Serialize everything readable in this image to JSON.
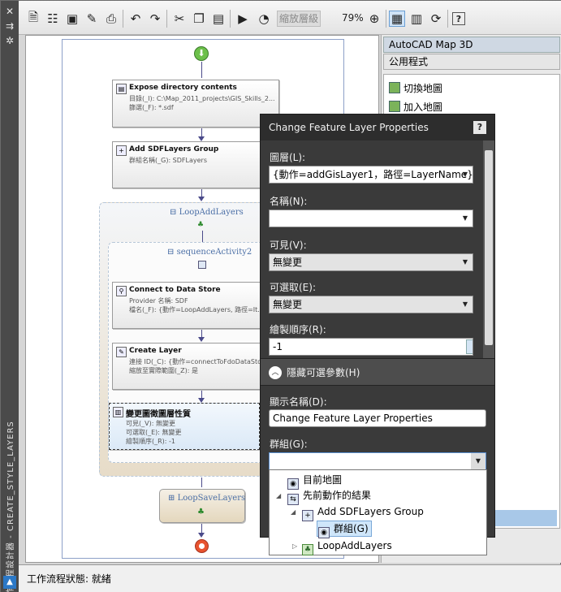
{
  "sidebar": {
    "vertical_title": "工作流程設計器 - CREATE_STYLE_LAYERS",
    "close_glyph": "✕",
    "pin_glyph": "⇉",
    "settings_glyph": "✲",
    "badge_glyph": "▲"
  },
  "toolbar": {
    "icons": [
      "new-workflow-icon",
      "properties-icon",
      "save-icon",
      "edit-icon",
      "print-icon",
      "undo-icon",
      "redo-icon",
      "cut-icon",
      "copy-icon",
      "paste-icon",
      "run-icon",
      "ungroup-icon"
    ],
    "zoom_label": "縮放層級",
    "zoom_value": "79%",
    "right_icons": [
      "zoom-icon",
      "layout-panel-icon",
      "document-icon",
      "refresh-icon",
      "help-icon"
    ]
  },
  "workflow": {
    "activities": [
      {
        "title": "Expose directory contents",
        "lines": [
          "目錄(_I): C:\\Map_2011_projects\\GIS_Skills_2...",
          "篩選(_F): *.sdf"
        ]
      },
      {
        "title": "Add SDFLayers Group",
        "lines": [
          "群組名稱(_G): SDFLayers"
        ]
      },
      {
        "title": "Connect to Data Store",
        "lines": [
          "Provider 名稱: SDF",
          "檔名(_F): {動作=LoopAddLayers, 路徑=It..."
        ]
      },
      {
        "title": "Create Layer",
        "lines": [
          "連接 ID(_C): {動作=connectToFdoDataSto...",
          "縮放至實際範圍(_Z): 是"
        ]
      },
      {
        "title": "變更圖徵圖層性質",
        "lines": [
          "可見(_V): 無變更",
          "可選取(_E): 無變更",
          "繪製順序(_R): -1"
        ]
      }
    ],
    "loop_label": "LoopAddLayers",
    "sequence_label": "sequenceActivity2",
    "save_label": "LoopSaveLayers"
  },
  "right_panel": {
    "tab1": "AutoCAD Map 3D",
    "tab2": "公用程式",
    "items": [
      "切換地圖",
      "加入地圖"
    ]
  },
  "dialog": {
    "title": "Change Feature Layer Properties",
    "help": "?",
    "layer_label": "圖層(L):",
    "layer_value": "{動作=addGisLayer1，路徑=LayerName}",
    "name_label": "名稱(N):",
    "name_value": "",
    "visible_label": "可見(V):",
    "visible_value": "無變更",
    "selectable_label": "可選取(E):",
    "selectable_value": "無變更",
    "draw_order_label": "繪製順序(R):",
    "draw_order_value": "-1",
    "section_label": "隱藏可選參數(H)",
    "display_name_label": "顯示名稱(D):",
    "display_name_value": "Change Feature Layer Properties",
    "group_label": "群組(G):",
    "group_value": ""
  },
  "group_tree": {
    "items": [
      {
        "label": "目前地圖"
      },
      {
        "label": "先前動作的結果"
      },
      {
        "label": "Add SDFLayers Group"
      },
      {
        "label": "群組(G)"
      },
      {
        "label": "LoopAddLayers"
      }
    ]
  },
  "status": {
    "text": "工作流程狀態: 就緒"
  }
}
